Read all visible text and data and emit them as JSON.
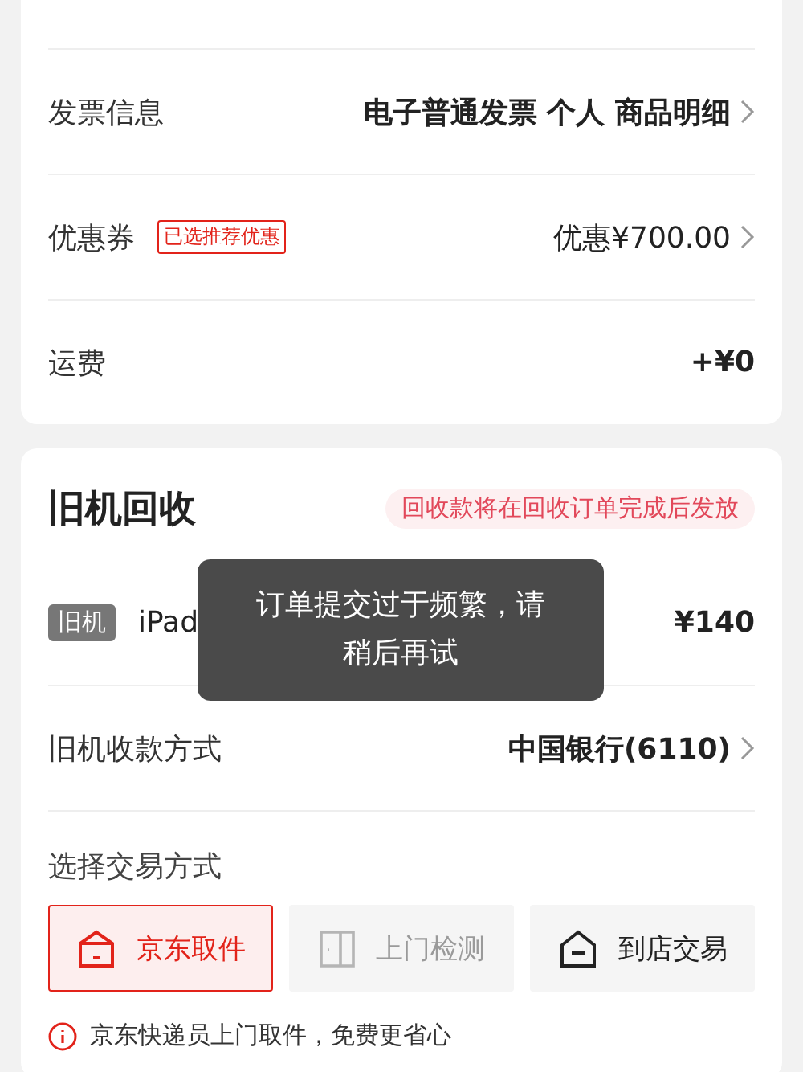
{
  "order_rows": [
    {
      "kind": "link",
      "label": "发票信息",
      "value": "电子普通发票 个人 商品明细",
      "bold": true
    },
    {
      "kind": "link",
      "label": "优惠券",
      "tag": "已选推荐优惠",
      "value": "优惠¥700.00",
      "bold": false
    },
    {
      "kind": "plain",
      "label": "运费",
      "value": "+¥0",
      "bold": true
    }
  ],
  "trade_in": {
    "title": "旧机回收",
    "notice": "回收款将在回收订单完成后发放",
    "device": {
      "tag": "旧机",
      "name": "iPad",
      "price": "¥140"
    },
    "payout": {
      "label": "旧机收款方式",
      "value": "中国银行(6110)"
    },
    "method_title": "选择交易方式",
    "methods": [
      {
        "kind": "pickup",
        "label": "京东取件",
        "selected": true,
        "disabled": false
      },
      {
        "kind": "visit",
        "label": "上门检测",
        "selected": false,
        "disabled": true
      },
      {
        "kind": "store",
        "label": "到店交易",
        "selected": false,
        "disabled": false
      }
    ],
    "tip": "京东快递员上门取件，免费更省心"
  },
  "toast": "订单提交过于频繁，请稍后再试"
}
